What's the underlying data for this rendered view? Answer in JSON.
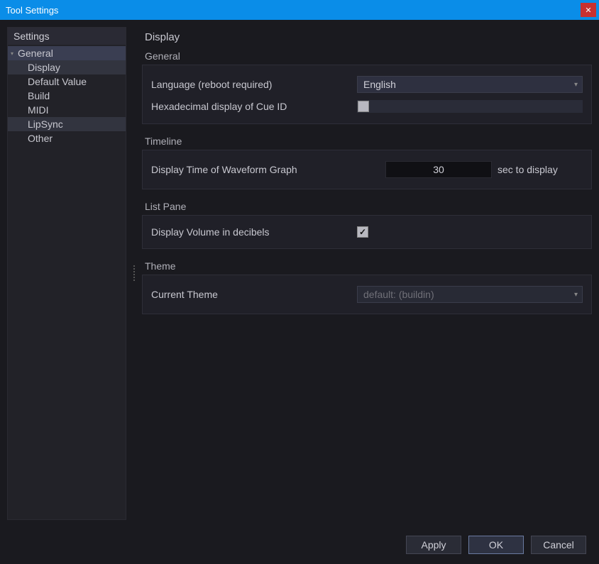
{
  "window": {
    "title": "Tool Settings"
  },
  "sidebar": {
    "header": "Settings",
    "items": [
      {
        "label": "General",
        "type": "parent",
        "selected": true
      },
      {
        "label": "Display",
        "type": "child",
        "selected": false,
        "highlight": true
      },
      {
        "label": "Default Value",
        "type": "child",
        "selected": false
      },
      {
        "label": "Build",
        "type": "child",
        "selected": false
      },
      {
        "label": "MIDI",
        "type": "child",
        "selected": false
      },
      {
        "label": "LipSync",
        "type": "child",
        "selected": false,
        "highlight": true
      },
      {
        "label": "Other",
        "type": "child",
        "selected": false
      }
    ]
  },
  "panel": {
    "title": "Display",
    "groups": {
      "general": {
        "header": "General",
        "language_label": "Language (reboot required)",
        "language_value": "English",
        "hex_label": "Hexadecimal display of Cue ID",
        "hex_checked": false
      },
      "timeline": {
        "header": "Timeline",
        "display_time_label": "Display Time of Waveform Graph",
        "display_time_value": "30",
        "display_time_suffix": "sec to display"
      },
      "listpane": {
        "header": "List Pane",
        "decibels_label": "Display Volume in decibels",
        "decibels_checked": true
      },
      "theme": {
        "header": "Theme",
        "current_label": "Current Theme",
        "current_value": "default: (buildin)"
      }
    }
  },
  "footer": {
    "apply": "Apply",
    "ok": "OK",
    "cancel": "Cancel"
  }
}
